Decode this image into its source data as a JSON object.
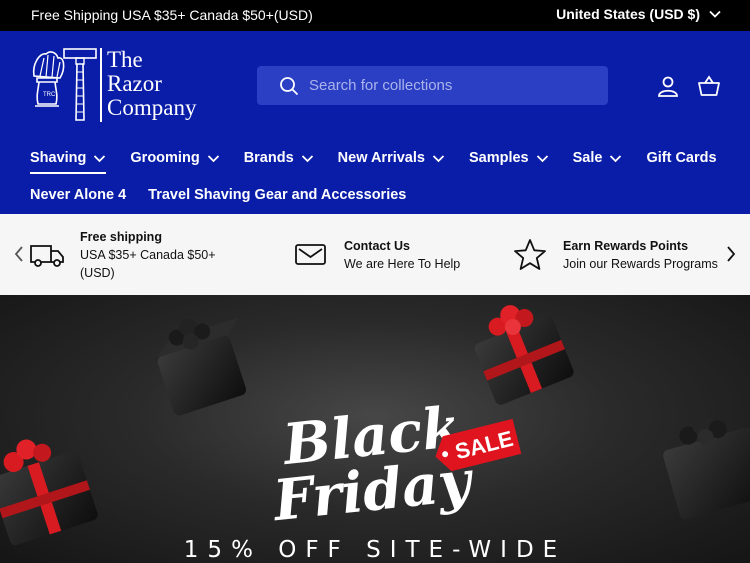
{
  "announcement": {
    "message": "Free Shipping USA $35+ Canada $50+(USD)",
    "country_selector": "United States (USD $)"
  },
  "header": {
    "logo": {
      "line1": "The",
      "line2": "Razor",
      "line3": "Company"
    },
    "search_placeholder": "Search for collections",
    "icons": [
      "search-icon",
      "account-icon",
      "cart-icon"
    ],
    "colors": {
      "header_bg": "#0a1da8",
      "search_bg": "#2b3fc4"
    }
  },
  "nav": {
    "primary": [
      {
        "label": "Shaving",
        "dropdown": true,
        "active": true
      },
      {
        "label": "Grooming",
        "dropdown": true
      },
      {
        "label": "Brands",
        "dropdown": true
      },
      {
        "label": "New Arrivals",
        "dropdown": true
      },
      {
        "label": "Samples",
        "dropdown": true
      },
      {
        "label": "Sale",
        "dropdown": true
      },
      {
        "label": "Gift Cards",
        "dropdown": false
      }
    ],
    "secondary": [
      {
        "label": "Never Alone 4"
      },
      {
        "label": "Travel Shaving Gear and Accessories"
      }
    ]
  },
  "benefits": [
    {
      "icon": "truck-icon",
      "title": "Free shipping",
      "line1": "USA $35+ Canada $50+",
      "line2": "(USD)"
    },
    {
      "icon": "envelope-icon",
      "title": "Contact Us",
      "line1": "We are Here To Help"
    },
    {
      "icon": "star-icon",
      "title": "Earn Rewards Points",
      "line1": "Join our Rewards Programs"
    }
  ],
  "hero": {
    "headline_line1": "Black",
    "headline_line2": "Friday",
    "tag": "SALE",
    "subheadline": "15% OFF SITE-WIDE",
    "colors": {
      "tag": "#e0141e",
      "ribbon": "#d81b20"
    }
  }
}
